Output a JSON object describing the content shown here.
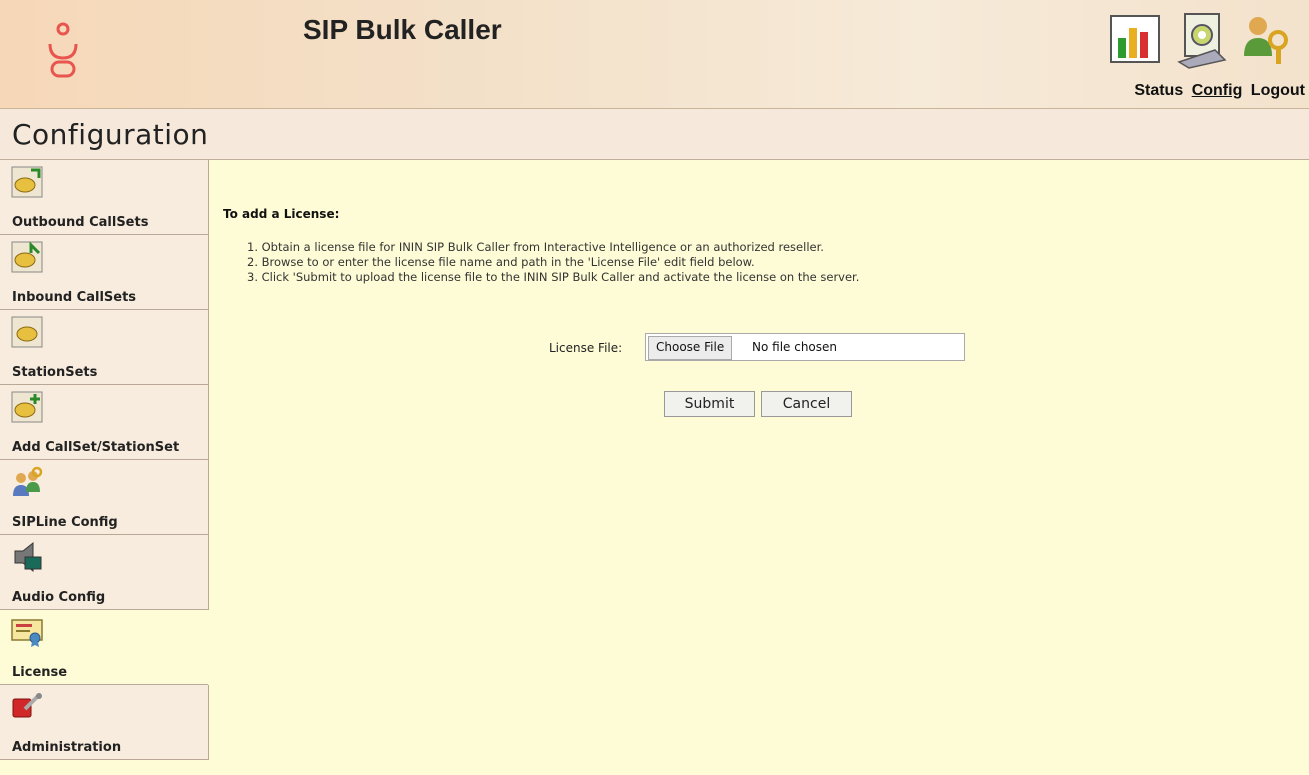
{
  "header": {
    "app_title": "SIP Bulk Caller",
    "logo_icon": "genesys-logo",
    "icons": [
      "status-chart-icon",
      "config-gear-icon",
      "logout-key-icon"
    ],
    "links": {
      "status": "Status",
      "config": "Config",
      "logout": "Logout"
    }
  },
  "page": {
    "title": "Configuration"
  },
  "sidebar": {
    "items": [
      {
        "label": "Outbound CallSets",
        "icon": "phone-outbound-icon"
      },
      {
        "label": "Inbound CallSets",
        "icon": "phone-inbound-icon"
      },
      {
        "label": "StationSets",
        "icon": "phone-icon"
      },
      {
        "label": "Add CallSet/StationSet",
        "icon": "phone-add-icon"
      },
      {
        "label": "SIPLine Config",
        "icon": "users-key-icon"
      },
      {
        "label": "Audio Config",
        "icon": "speaker-icon"
      },
      {
        "label": "License",
        "icon": "certificate-icon",
        "active": true
      },
      {
        "label": "Administration",
        "icon": "tools-icon"
      }
    ]
  },
  "main": {
    "instructions_title": "To add a License:",
    "steps": [
      "1. Obtain a license file for ININ SIP Bulk Caller from Interactive Intelligence or an authorized reseller.",
      "2. Browse to or enter the license file name and path in the 'License File' edit field below.",
      "3. Click 'Submit to upload the license file to the ININ SIP Bulk Caller and activate the license on the server."
    ],
    "license_label": "License File:",
    "choose_file": "Choose File",
    "no_file": "No file chosen",
    "submit": "Submit",
    "cancel": "Cancel"
  },
  "colors": {
    "background": "#fefcd6",
    "header": "#f3e0c8",
    "sidebar_item": "#f7ecdd",
    "logo": "#e8554e"
  }
}
